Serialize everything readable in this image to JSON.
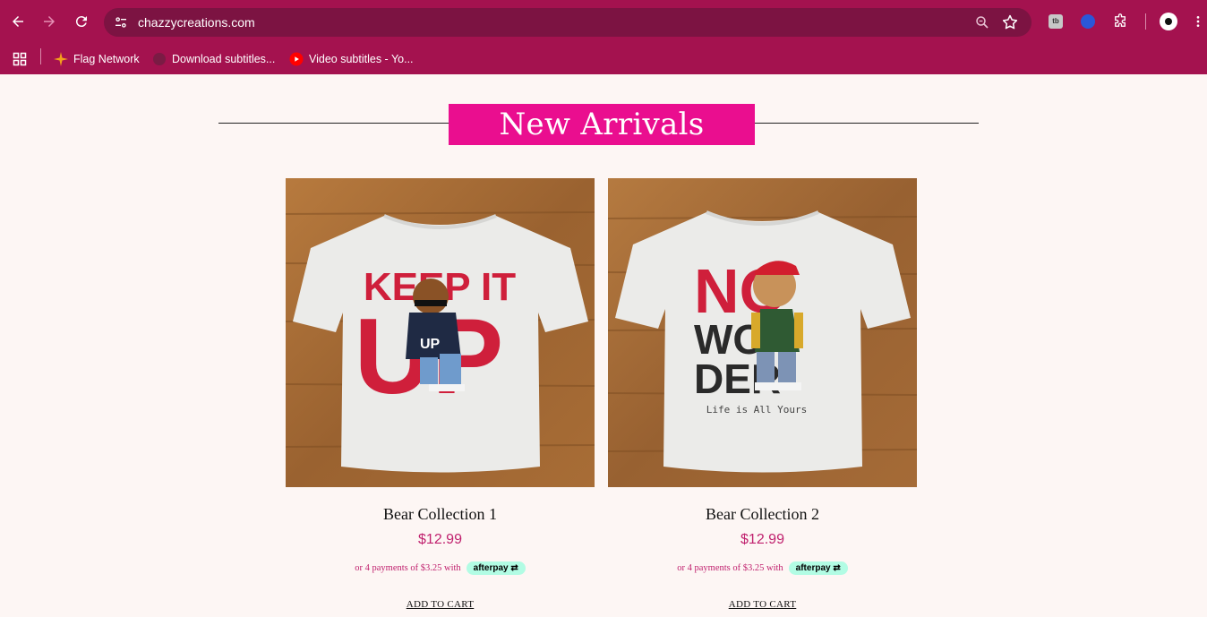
{
  "browser": {
    "url": "chazzycreations.com",
    "bookmarks": [
      {
        "label": "Flag Network"
      },
      {
        "label": "Download subtitles..."
      },
      {
        "label": "Video subtitles - Yo..."
      }
    ]
  },
  "page": {
    "section_title": "New Arrivals",
    "products": [
      {
        "name": "Bear Collection 1",
        "price": "$12.99",
        "installments_text": "or 4 payments of $3.25 with",
        "afterpay_label": "afterpay",
        "add_to_cart": "ADD TO CART",
        "shirt_text_line1": "KEEP IT",
        "shirt_text_line2": "UP",
        "bear_shirt_text": "UP"
      },
      {
        "name": "Bear Collection 2",
        "price": "$12.99",
        "installments_text": "or 4 payments of $3.25 with",
        "afterpay_label": "afterpay",
        "add_to_cart": "ADD TO CART",
        "shirt_text_line1": "NO",
        "shirt_text_line2": "WON",
        "shirt_text_line3": "DER",
        "shirt_tagline": "Life is All Yours"
      }
    ]
  },
  "colors": {
    "chrome": "#a4124f",
    "omnibox": "#7c1342",
    "banner": "#ea0e8f",
    "price": "#c0216e",
    "page_bg": "#fdf6f4",
    "afterpay": "#b2fce4"
  }
}
